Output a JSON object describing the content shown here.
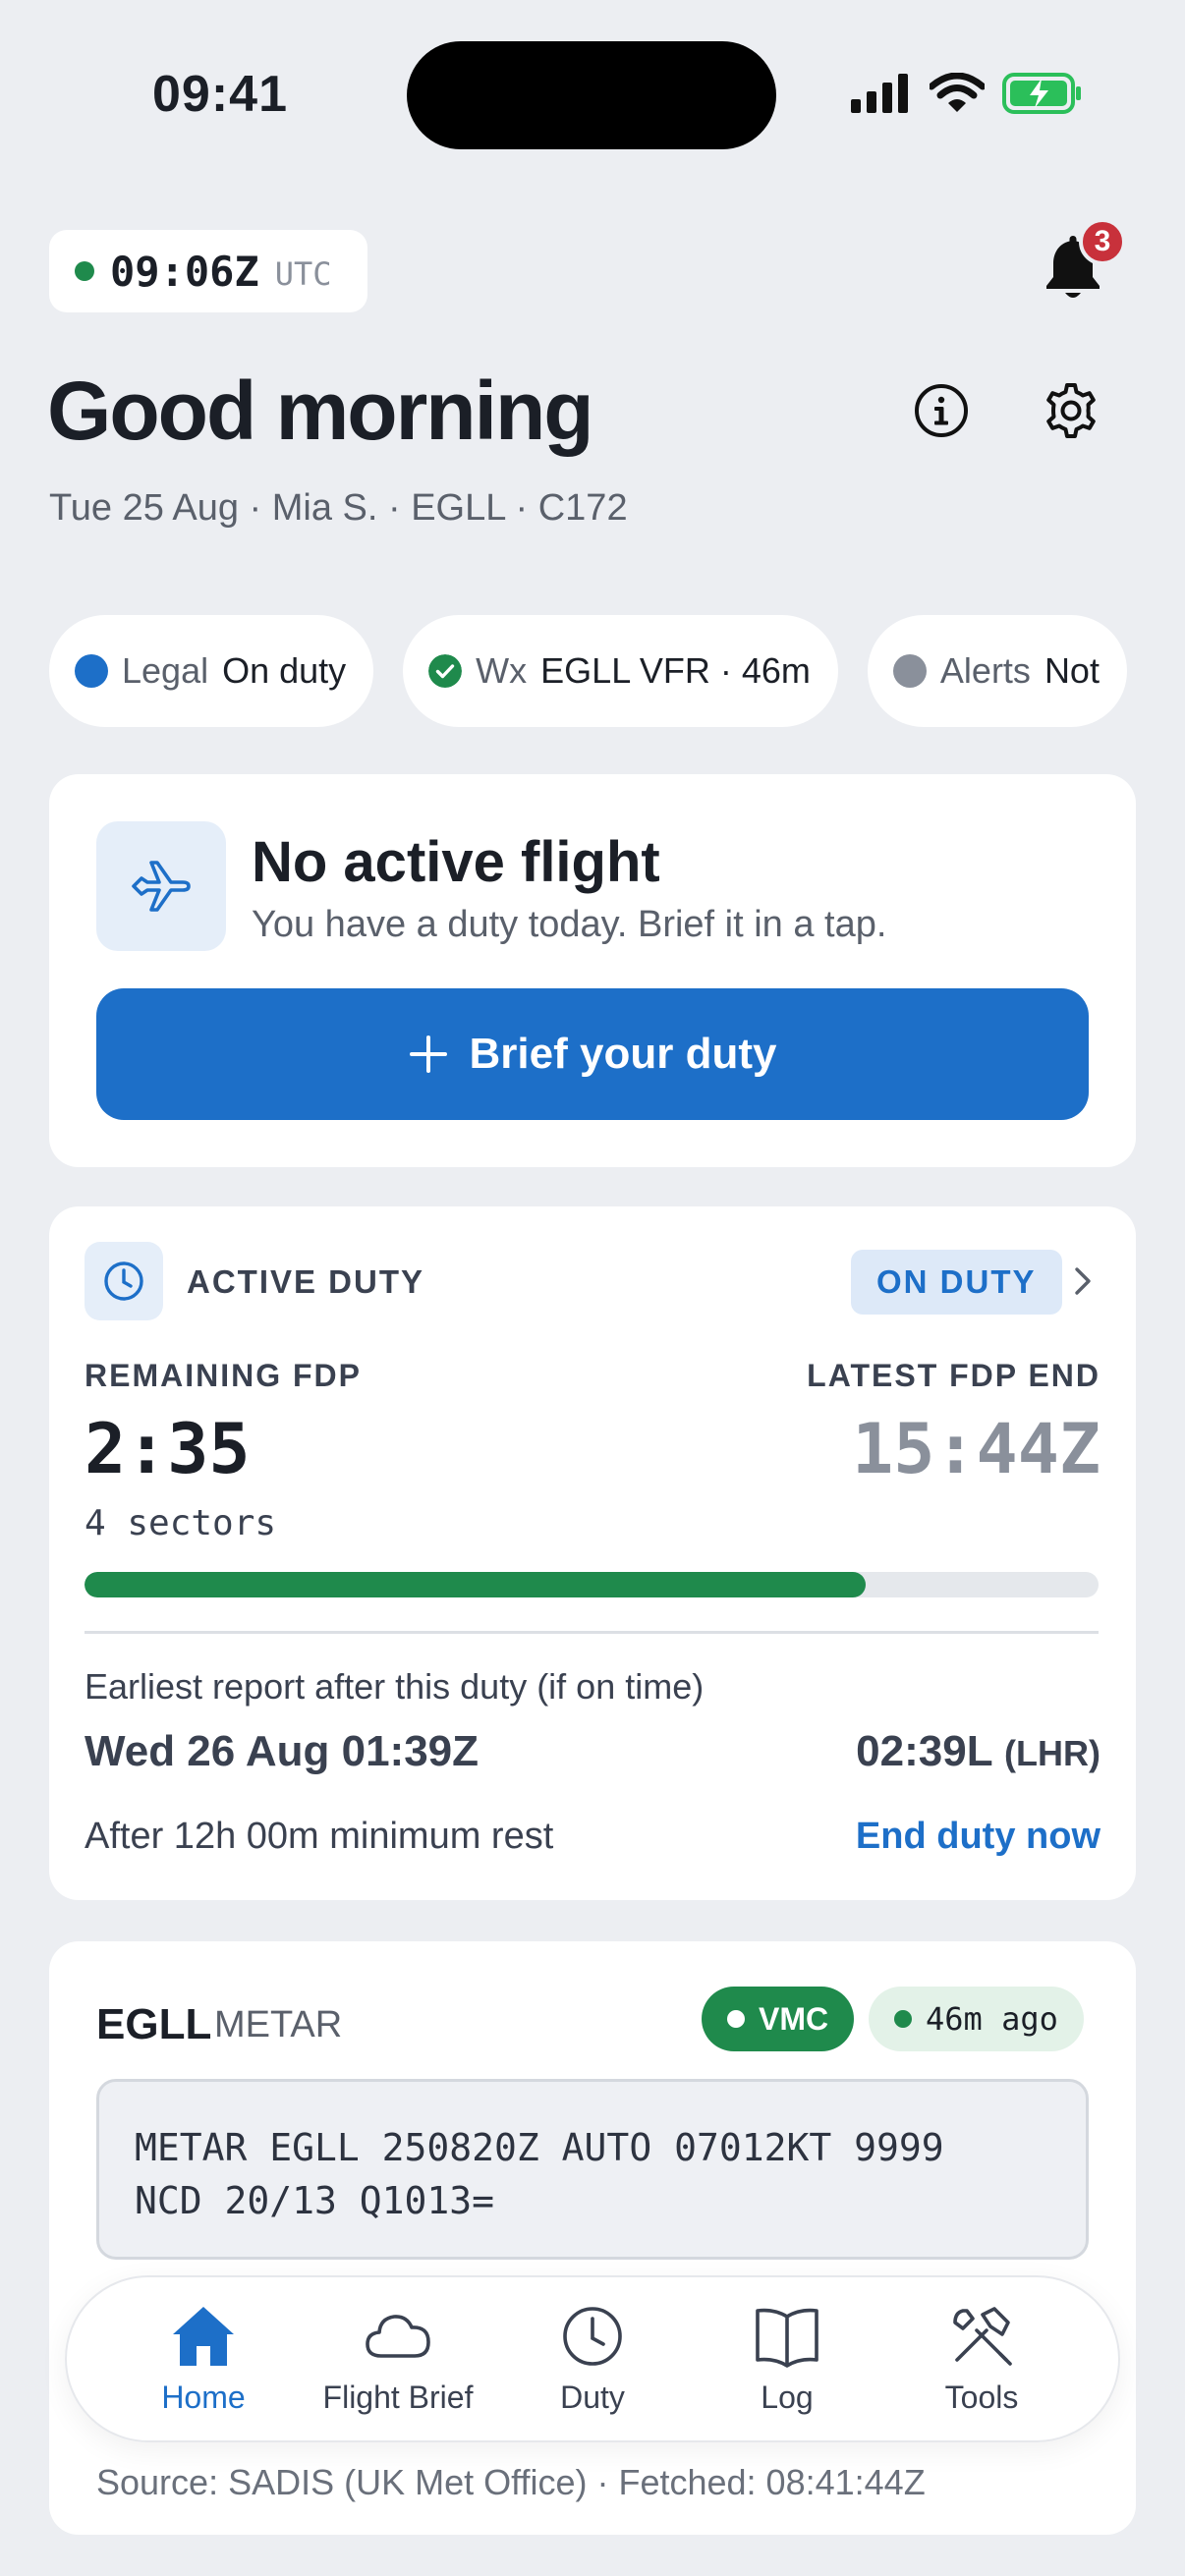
{
  "status_bar": {
    "time": "09:41"
  },
  "header": {
    "utc_time": "09:06Z",
    "utc_label": "UTC",
    "notification_count": "3",
    "greeting": "Good morning",
    "subline": "Tue 25 Aug · Mia S. · EGLL · C172"
  },
  "chips": [
    {
      "key": "Legal",
      "value": "On duty",
      "dot_color": "#1d6fc8"
    },
    {
      "key": "Wx",
      "value": "EGLL VFR · 46m",
      "dot_color": "#1f8a4c"
    },
    {
      "key": "Alerts",
      "value": "Not",
      "dot_color": "#8a909b"
    }
  ],
  "no_flight": {
    "title": "No active flight",
    "subtitle": "You have a duty today. Brief it in a tap.",
    "button_label": "Brief your duty"
  },
  "duty": {
    "title": "ACTIVE DUTY",
    "badge": "ON DUTY",
    "remaining_label": "REMAINING FDP",
    "remaining_value": "2:35",
    "latest_label": "LATEST FDP END",
    "latest_value": "15:44Z",
    "sectors": "4 sectors",
    "progress_fraction": 0.77,
    "earliest_label": "Earliest report after this duty (if on time)",
    "earliest_date": "Wed 26 Aug 01:39Z",
    "earliest_local": "02:39L",
    "earliest_local_tz": "(LHR)",
    "rest_text": "After 12h 00m minimum rest",
    "end_duty_label": "End duty now"
  },
  "metar": {
    "station": "EGLL",
    "label": "METAR",
    "condition": "VMC",
    "age": "46m ago",
    "raw": "METAR EGLL 250820Z AUTO 07012KT 9999\nNCD 20/13 Q1013=",
    "source": "Source: SADIS (UK Met Office) · Fetched: 08:41:44Z"
  },
  "tabs": [
    {
      "label": "Home",
      "icon": "home-icon",
      "active": true
    },
    {
      "label": "Flight Brief",
      "icon": "cloud-icon",
      "active": false
    },
    {
      "label": "Duty",
      "icon": "clock-icon",
      "active": false
    },
    {
      "label": "Log",
      "icon": "book-icon",
      "active": false
    },
    {
      "label": "Tools",
      "icon": "tools-icon",
      "active": false
    }
  ],
  "colors": {
    "accent": "#1d6fc8",
    "success": "#1f8a4c",
    "danger": "#c8313b",
    "background": "#eceef2"
  }
}
